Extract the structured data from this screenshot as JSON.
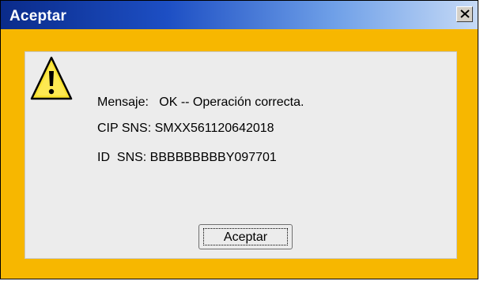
{
  "dialog": {
    "title": "Aceptar",
    "close_icon": "close-icon",
    "warning_icon": "warning-icon",
    "message": {
      "line1": "Mensaje:   OK -- Operación correcta.",
      "line2": "CIP SNS: SMXX561120642018",
      "line3": "ID  SNS: BBBBBBBBBY097701"
    },
    "ok_button_label": "Aceptar"
  },
  "colors": {
    "title_bar_start": "#0a2b8a",
    "title_bar_end": "#c6daf6",
    "frame": "#f7b700",
    "panel": "#ececec"
  }
}
